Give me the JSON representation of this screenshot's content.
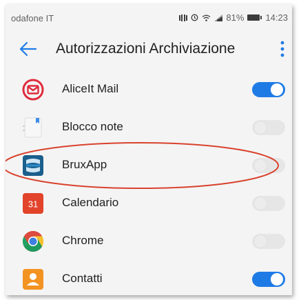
{
  "status_bar": {
    "carrier": "odafone IT",
    "battery_text": "81%",
    "time": "14:23"
  },
  "app_bar": {
    "title": "Autorizzazioni Archiviazione"
  },
  "apps": [
    {
      "label": "AliceIt Mail",
      "enabled": true,
      "icon": "aliceit-mail-icon"
    },
    {
      "label": "Blocco note",
      "enabled": false,
      "icon": "notepad-icon"
    },
    {
      "label": "BruxApp",
      "enabled": false,
      "icon": "bruxapp-icon"
    },
    {
      "label": "Calendario",
      "enabled": false,
      "icon": "calendar-icon",
      "icon_text": "31"
    },
    {
      "label": "Chrome",
      "enabled": false,
      "icon": "chrome-icon"
    },
    {
      "label": "Contatti",
      "enabled": true,
      "icon": "contacts-icon"
    }
  ],
  "colors": {
    "accent": "#1e7be6",
    "highlight_ellipse": "#d9412c"
  }
}
